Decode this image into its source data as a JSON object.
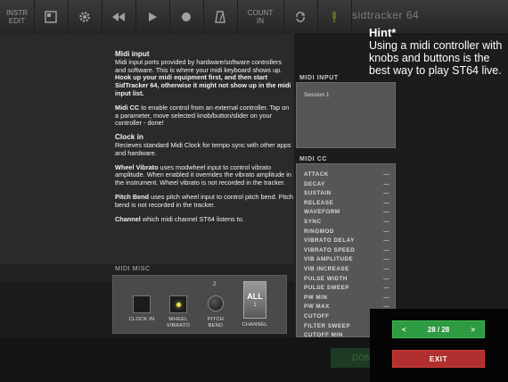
{
  "toolbar": {
    "instr_edit_label": "INSTR\nEDIT",
    "count_in_label": "COUNT\nIN",
    "app_title": "sidtracker 64"
  },
  "help": {
    "sections": [
      {
        "title": "Midi input",
        "body_pre": "Midi input ports provided by hardware/software controllers and software. This is where your midi keyboard shows up. ",
        "body_bold": "Hook up your midi equipment first, and then start SidTracker 64, otherwise it might not show up in the midi input list."
      },
      {
        "title": "Midi CC",
        "body": " to enable control from an external controller. Tap on a parameter, move selected knob/button/slider on your controller - done!"
      },
      {
        "title": "Clock in",
        "body": "Recieves standard Midi Clock for tempo sync with other apps and hardware."
      },
      {
        "title": "Wheel Vibrato",
        "body": " uses modwheel input to control vibrato amplitude. When enabled it overrides the vibrato amplitude in the instrument. Wheel vibrato is not recorded in the tracker."
      },
      {
        "title": "Pitch Bend",
        "body": " uses pitch wheel input to control pitch bend. Pitch bend is not recorded in the tracker."
      },
      {
        "title": "Channel",
        "body": " which midi channel ST64 listens to."
      }
    ]
  },
  "midi_misc": {
    "label": "MIDI MISC",
    "clock_in_label": "CLOCK IN",
    "wheel_vibrato_label": "WHEEL\nVIBRATO",
    "pitch_bend_label": "PITCH\nBEND",
    "pitch_bend_value": "2",
    "channel_label": "CHANNEL",
    "channel_value": "ALL",
    "channel_sub": "1"
  },
  "midi_input": {
    "label": "MIDI INPUT",
    "session": "Session 1"
  },
  "midi_cc": {
    "label": "MIDI CC",
    "items": [
      {
        "name": "ATTACK",
        "value": "—"
      },
      {
        "name": "DECAY",
        "value": "—"
      },
      {
        "name": "SUSTAIN",
        "value": "—"
      },
      {
        "name": "RELEASE",
        "value": "—"
      },
      {
        "name": "WAVEFORM",
        "value": "—"
      },
      {
        "name": "SYNC",
        "value": "—"
      },
      {
        "name": "RINGMOD",
        "value": "—"
      },
      {
        "name": "VIBRATO DELAY",
        "value": "—"
      },
      {
        "name": "VIBRATO SPEED",
        "value": "—"
      },
      {
        "name": "VIB AMPLITUDE",
        "value": "—"
      },
      {
        "name": "VIB INCREASE",
        "value": "—"
      },
      {
        "name": "PULSE WIDTH",
        "value": "—"
      },
      {
        "name": "PULSE SWEEP",
        "value": "—"
      },
      {
        "name": "PW MIN",
        "value": "—"
      },
      {
        "name": "PW MAX",
        "value": "—"
      },
      {
        "name": "CUTOFF",
        "value": "—"
      },
      {
        "name": "FILTER SWEEP",
        "value": "—"
      },
      {
        "name": "CUTOFF MIN",
        "value": "—"
      }
    ]
  },
  "hint": {
    "title": "Hint*",
    "text": "Using a midi controller with knobs and buttons is the best way to play ST64 live."
  },
  "nav": {
    "prev_label": "<",
    "page": "28 / 28",
    "next_label": ">",
    "exit_label": "EXIT"
  },
  "background": {
    "done_label": "DON"
  },
  "colors": {
    "accent_green": "#2e9a41",
    "accent_red": "#b22f2f",
    "led_on": "#e6e64a"
  }
}
